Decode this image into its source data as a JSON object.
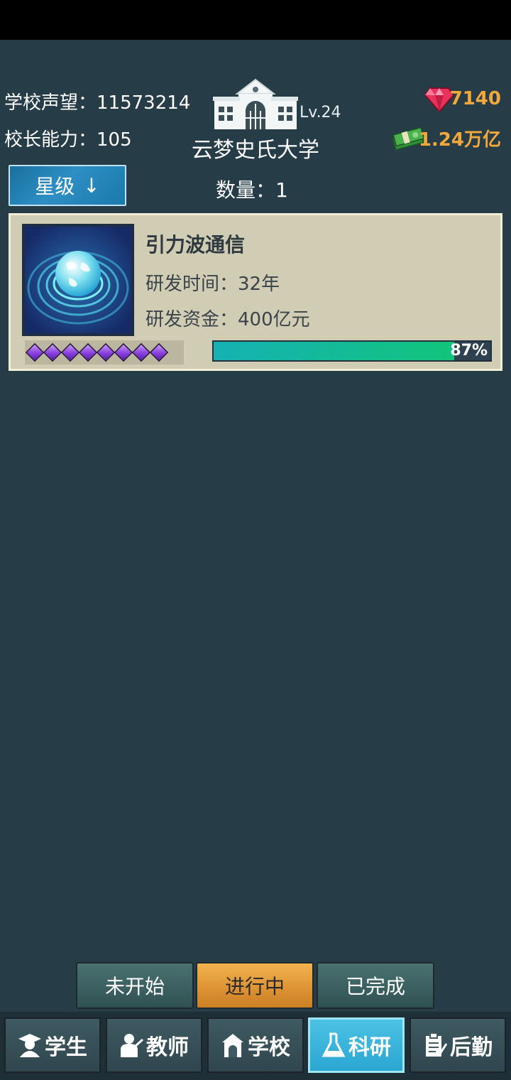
{
  "header": {
    "reputation_label": "学校声望：",
    "reputation_value": "11573214",
    "ability_label": "校长能力：",
    "ability_value": "105",
    "level": "Lv.24",
    "school_name": "云梦史氏大学",
    "gems": "7140",
    "money": "1.24万亿"
  },
  "controls": {
    "sort_label": "星级",
    "sort_arrow": "↓",
    "count_label": "数量：",
    "count_value": "1"
  },
  "research_item": {
    "title": "引力波通信",
    "time_label": "研发时间：",
    "time_value": "32年",
    "fund_label": "研发资金：",
    "fund_value": "400亿元",
    "stars": 8,
    "progress_percent": 87,
    "progress_text": "87%",
    "icon": "globe-wave-icon"
  },
  "filters": {
    "not_started": "未开始",
    "in_progress": "进行中",
    "completed": "已完成",
    "active": "in_progress"
  },
  "nav": {
    "students": "学生",
    "teachers": "教师",
    "school": "学校",
    "research": "科研",
    "logistics": "后勤",
    "active": "research"
  },
  "colors": {
    "background": "#263c47",
    "currency": "#f2a83a",
    "card": "#d1cdb5",
    "active_tab": "#dc9233",
    "active_nav": "#2aa6d2"
  }
}
